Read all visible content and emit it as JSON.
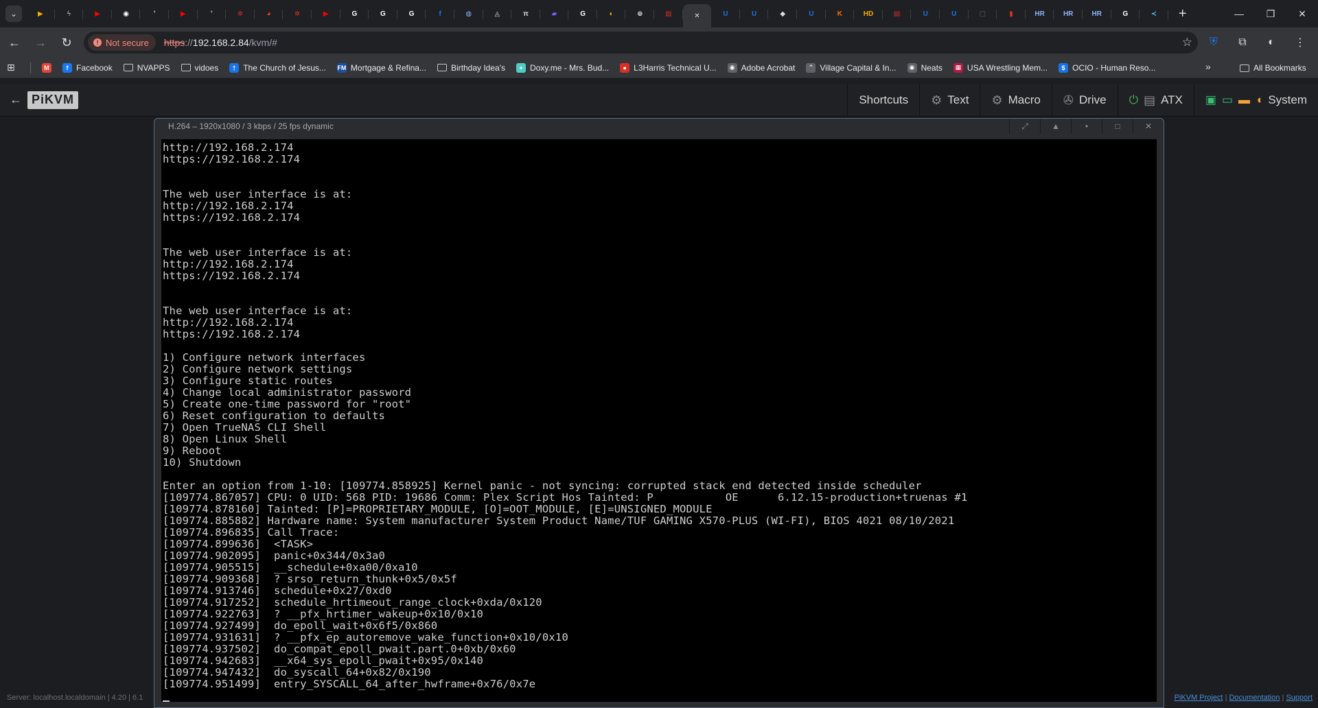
{
  "browser": {
    "tabs": [
      {
        "icon": "play-icon",
        "color": "#f9ab00"
      },
      {
        "icon": "bolt-icon",
        "color": "#9aa0a6"
      },
      {
        "icon": "youtube-icon",
        "color": "#ff0000"
      },
      {
        "icon": "circle-u-icon",
        "color": "#ffffff"
      },
      {
        "icon": "quote-icon",
        "color": "#9aa0a6"
      },
      {
        "icon": "youtube-icon",
        "color": "#ff0000"
      },
      {
        "icon": "quote-icon",
        "color": "#9aa0a6"
      },
      {
        "icon": "gear-red-icon",
        "color": "#d93025"
      },
      {
        "icon": "reddit-icon",
        "color": "#ff4500"
      },
      {
        "icon": "gear-red-icon",
        "color": "#d93025"
      },
      {
        "icon": "youtube-icon",
        "color": "#ff0000"
      },
      {
        "icon": "google-icon",
        "color": "#ffffff"
      },
      {
        "icon": "google-icon",
        "color": "#ffffff"
      },
      {
        "icon": "google-icon",
        "color": "#ffffff"
      },
      {
        "icon": "facebook-icon",
        "color": "#1877f2"
      },
      {
        "icon": "messenger-icon",
        "color": "#8ab4f8"
      },
      {
        "icon": "a-logo-icon",
        "color": "#dadce0"
      },
      {
        "icon": "pi-icon",
        "color": "#dadce0"
      },
      {
        "icon": "chart-icon",
        "color": "#7b61ff"
      },
      {
        "icon": "google-icon",
        "color": "#ffffff"
      },
      {
        "icon": "lemon-icon",
        "color": "#fbbc04"
      },
      {
        "icon": "lifebuoy-icon",
        "color": "#dadce0"
      },
      {
        "icon": "calendar-icon",
        "color": "#d93025"
      },
      {
        "icon": "close-icon",
        "color": "#dadce0",
        "active": true
      },
      {
        "icon": "u-icon",
        "color": "#1a73e8"
      },
      {
        "icon": "u-icon",
        "color": "#1a73e8"
      },
      {
        "icon": "diamond-icon",
        "color": "#dadce0"
      },
      {
        "icon": "u-icon",
        "color": "#1a73e8"
      },
      {
        "icon": "k-icon",
        "color": "#ff6d00"
      },
      {
        "icon": "hd-icon",
        "color": "#f9ab00"
      },
      {
        "icon": "calendar-icon",
        "color": "#d93025"
      },
      {
        "icon": "u-icon",
        "color": "#1a73e8"
      },
      {
        "icon": "u-icon",
        "color": "#1a73e8"
      },
      {
        "icon": "app-icon",
        "color": "#5f6368"
      },
      {
        "icon": "card-icon",
        "color": "#d93025"
      },
      {
        "icon": "hr-icon",
        "color": "#8ab4f8"
      },
      {
        "icon": "hr-icon",
        "color": "#8ab4f8"
      },
      {
        "icon": "hr-icon",
        "color": "#8ab4f8"
      },
      {
        "icon": "google-icon",
        "color": "#ffffff"
      },
      {
        "icon": "vs-icon",
        "color": "#4fc3f7"
      }
    ],
    "security_label": "Not secure",
    "url_scheme": "https",
    "url_sep": "://",
    "url_host": "192.168.2.84",
    "url_path": "/kvm/#",
    "bookmarks": [
      {
        "label": "",
        "icon": "gmail-icon",
        "color": "#ea4335",
        "glyph": "M"
      },
      {
        "label": "Facebook",
        "icon": "facebook-icon",
        "color": "#1877f2",
        "glyph": "f"
      },
      {
        "label": "NVAPPS",
        "icon": "folder-icon"
      },
      {
        "label": "vidoes",
        "icon": "folder-icon"
      },
      {
        "label": "The Church of Jesus...",
        "icon": "church-icon",
        "color": "#1a73e8",
        "glyph": "†"
      },
      {
        "label": "Mortgage & Refina...",
        "icon": "fm-icon",
        "color": "#1a4fa0",
        "glyph": "FM"
      },
      {
        "label": "Birthday Idea's",
        "icon": "folder-icon"
      },
      {
        "label": "Doxy.me - Mrs. Bud...",
        "icon": "doxy-icon",
        "color": "#4ecdc4",
        "glyph": "+"
      },
      {
        "label": "L3Harris Technical U...",
        "icon": "l3harris-icon",
        "color": "#d93025",
        "glyph": "●"
      },
      {
        "label": "Adobe Acrobat",
        "icon": "globe-icon",
        "color": "#5f6368",
        "glyph": "◉"
      },
      {
        "label": "Village Capital & In...",
        "icon": "village-icon",
        "color": "#5f6368",
        "glyph": "⌃"
      },
      {
        "label": "Neats",
        "icon": "globe-icon",
        "color": "#5f6368",
        "glyph": "◉"
      },
      {
        "label": "USA Wrestling Mem...",
        "icon": "flag-icon",
        "color": "#b31942",
        "glyph": "▦"
      },
      {
        "label": "OCIO - Human Reso...",
        "icon": "ocio-icon",
        "color": "#1a73e8",
        "glyph": "$"
      }
    ],
    "all_bookmarks": "All Bookmarks"
  },
  "kvm": {
    "logo": "PiKVM",
    "menu": {
      "shortcuts": "Shortcuts",
      "text": "Text",
      "macro": "Macro",
      "drive": "Drive",
      "atx": "ATX",
      "system": "System"
    },
    "stream_title": "H.264 – 1920x1080 / 3 kbps / 25 fps dynamic",
    "terminal": [
      "http://192.168.2.174",
      "https://192.168.2.174",
      "",
      "",
      "The web user interface is at:",
      "http://192.168.2.174",
      "https://192.168.2.174",
      "",
      "",
      "The web user interface is at:",
      "http://192.168.2.174",
      "https://192.168.2.174",
      "",
      "",
      "The web user interface is at:",
      "http://192.168.2.174",
      "https://192.168.2.174",
      "",
      "1) Configure network interfaces",
      "2) Configure network settings",
      "3) Configure static routes",
      "4) Change local administrator password",
      "5) Create one-time password for \"root\"",
      "6) Reset configuration to defaults",
      "7) Open TrueNAS CLI Shell",
      "8) Open Linux Shell",
      "9) Reboot",
      "10) Shutdown",
      "",
      "Enter an option from 1-10: [109774.858925] Kernel panic - not syncing: corrupted stack end detected inside scheduler",
      "[109774.867057] CPU: 0 UID: 568 PID: 19686 Comm: Plex Script Hos Tainted: P           OE      6.12.15-production+truenas #1",
      "[109774.878160] Tainted: [P]=PROPRIETARY_MODULE, [O]=OOT_MODULE, [E]=UNSIGNED_MODULE",
      "[109774.885882] Hardware name: System manufacturer System Product Name/TUF GAMING X570-PLUS (WI-FI), BIOS 4021 08/10/2021",
      "[109774.896835] Call Trace:",
      "[109774.899636]  <TASK>",
      "[109774.902095]  panic+0x344/0x3a0",
      "[109774.905515]  __schedule+0xa00/0xa10",
      "[109774.909368]  ? srso_return_thunk+0x5/0x5f",
      "[109774.913746]  schedule+0x27/0xd0",
      "[109774.917252]  schedule_hrtimeout_range_clock+0xda/0x120",
      "[109774.922763]  ? __pfx_hrtimer_wakeup+0x10/0x10",
      "[109774.927499]  do_epoll_wait+0x6f5/0x860",
      "[109774.931631]  ? __pfx_ep_autoremove_wake_function+0x10/0x10",
      "[109774.937502]  do_compat_epoll_pwait.part.0+0xb/0x60",
      "[109774.942683]  __x64_sys_epoll_pwait+0x95/0x140",
      "[109774.947432]  do_syscall_64+0x82/0x190",
      "[109774.951499]  entry_SYSCALL_64_after_hwframe+0x76/0x7e"
    ],
    "footer_left": "Server: localhost.localdomain  |  4.20  |  6.1",
    "footer_links": {
      "project": "PiKVM Project",
      "docs": "Documentation",
      "support": "Support"
    },
    "footer_sep": "|"
  }
}
